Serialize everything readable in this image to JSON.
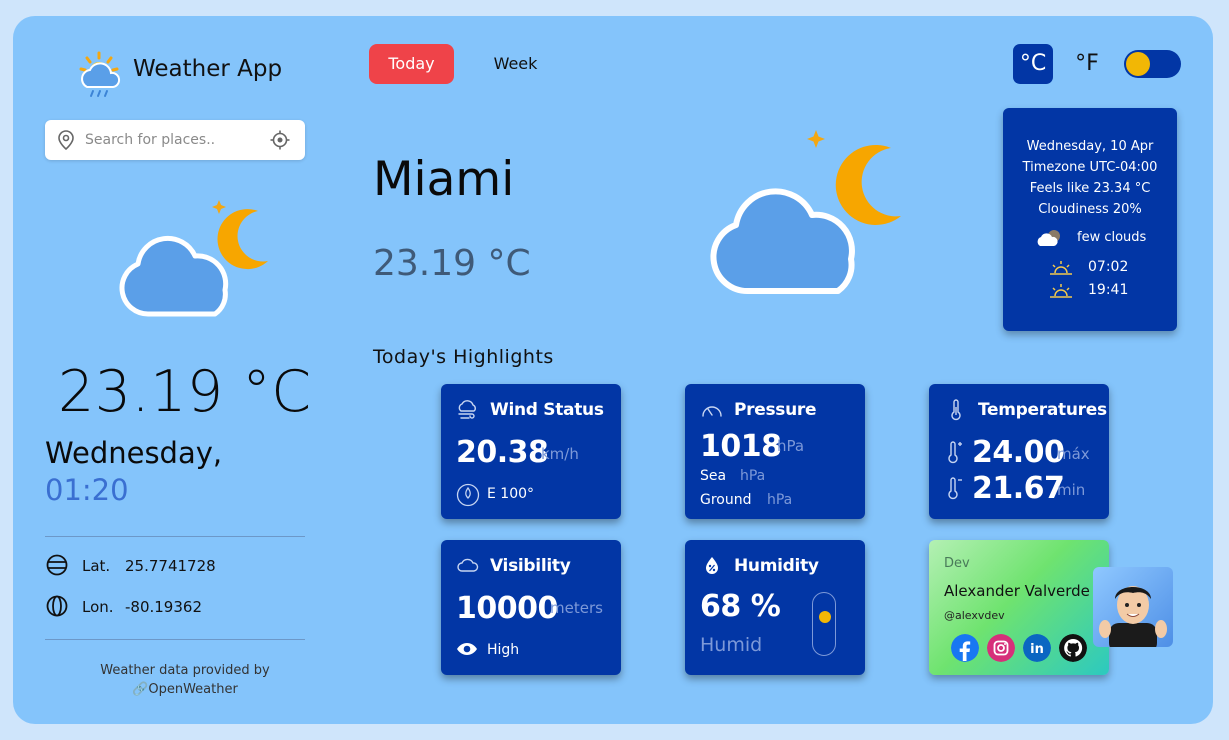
{
  "brand": {
    "title": "Weather App",
    "icon": "cloud-sun-rain-icon"
  },
  "search": {
    "placeholder": "Search for places..",
    "icon": "location-pin-icon",
    "locate_icon": "crosshair-icon"
  },
  "sidebar": {
    "temperature": "23.19 °C",
    "day": "Wednesday,",
    "time": "01:20",
    "lat_label": "Lat.",
    "lat_value": "25.7741728",
    "lon_label": "Lon.",
    "lon_value": "-80.19362",
    "credit_line1": "Weather data provided by",
    "credit_line2": "OpenWeather"
  },
  "tabs": {
    "today": "Today",
    "week": "Week"
  },
  "units": {
    "celsius": "°C",
    "fahrenheit": "°F"
  },
  "main": {
    "city": "Miami",
    "temperature": "23.19 °C"
  },
  "info": {
    "date": "Wednesday, 10 Apr",
    "timezone": "Timezone UTC-04:00",
    "feels_like": "Feels like 23.34 °C",
    "cloudiness": "Cloudiness 20%",
    "description": "few clouds",
    "sunrise": "07:02",
    "sunset": "19:41"
  },
  "highlights": {
    "title": "Today's Highlights",
    "wind": {
      "title": "Wind Status",
      "value": "20.38",
      "unit": "km/h",
      "direction": "E 100°"
    },
    "pressure": {
      "title": "Pressure",
      "value": "1018",
      "unit": "hPa",
      "sea_label": "Sea",
      "sea_unit": "hPa",
      "ground_label": "Ground",
      "ground_unit": "hPa"
    },
    "temperatures": {
      "title": "Temperatures",
      "max": "24.00",
      "max_label": "máx",
      "min": "21.67",
      "min_label": "min"
    },
    "visibility": {
      "title": "Visibility",
      "value": "10000",
      "unit": "meters",
      "level": "High"
    },
    "humidity": {
      "title": "Humidity",
      "value": "68 %",
      "label": "Humid",
      "fraction": 0.68
    }
  },
  "dev": {
    "label": "Dev",
    "name": "Alexander Valverde",
    "handle": "@alexvdev"
  },
  "colors": {
    "panel": "#84c4fb",
    "card": "#0236a5",
    "accent_red": "#ef4349",
    "accent_yellow": "#f2b705"
  }
}
